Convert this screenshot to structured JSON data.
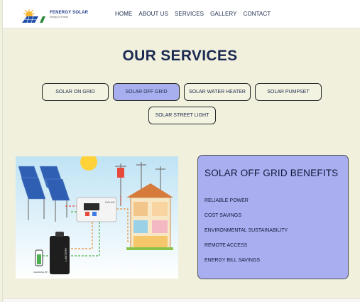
{
  "header": {
    "logo_name": "FENERGY SOLAR",
    "logo_tagline": "Energy of Future",
    "nav": [
      "HOME",
      "ABOUT US",
      "SERVICES",
      "GALLERY",
      "CONTACT"
    ]
  },
  "main": {
    "title": "OUR SERVICES",
    "tabs": [
      {
        "label": "SOLAR ON GRID",
        "active": false
      },
      {
        "label": "SOLAR OFF GRID",
        "active": true
      },
      {
        "label": "SOLAR WATER HEATER",
        "active": false
      },
      {
        "label": "SOLAR PUMPSET",
        "active": false
      },
      {
        "label": "SOLAR STREET LIGHT",
        "active": false
      }
    ],
    "illustration_labels": {
      "inverter": "SOLAR",
      "battery": "Li BATTERY",
      "small_battery": "CHARGING BTY"
    },
    "benefits": {
      "title": "SOLAR OFF GRID BENEFITS",
      "items": [
        "RELIABLE POWER",
        "COST SAVINGS",
        "ENVIRONMENTAL SUSTAINABILITY",
        "REMOTE ACCESS",
        "ENERGY BILL SAVINGS"
      ]
    }
  },
  "colors": {
    "background": "#f0f0dd",
    "active_tab": "#a8afee",
    "benefits_panel": "#a8aef0",
    "title": "#1c2a52"
  }
}
